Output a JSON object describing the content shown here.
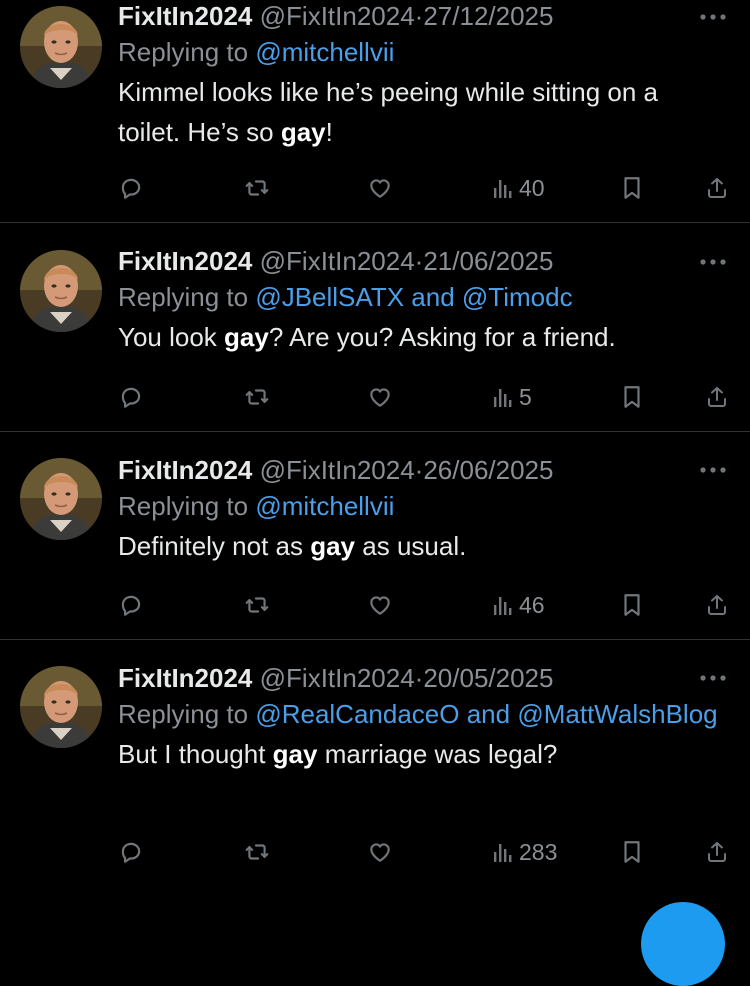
{
  "colors": {
    "background": "#000000",
    "text": "#e7e9ea",
    "muted": "#8b9096",
    "mention": "#4a9fe8",
    "divider": "#2f3336",
    "accent": "#1d9bf0"
  },
  "tweets": [
    {
      "display_name": "FixItIn2024",
      "handle": "@FixItIn2024",
      "separator": "·",
      "date": "27/12/2025",
      "reply_prefix": "Replying to",
      "reply_to": "@mitchellvii",
      "reply_joiner": "",
      "reply_to_2": "",
      "text_before": "Kimmel looks like he’s peeing while sitting on a toilet.  He’s so ",
      "text_bold": "gay",
      "text_after": "!",
      "views": "40",
      "icons": [
        "reply-icon",
        "retweet-icon",
        "like-icon",
        "views-icon",
        "bookmark-icon",
        "share-icon"
      ]
    },
    {
      "display_name": "FixItIn2024",
      "handle": "@FixItIn2024",
      "separator": "·",
      "date": "21/06/2025",
      "reply_prefix": "Replying to",
      "reply_to": "@JBellSATX",
      "reply_joiner": "and",
      "reply_to_2": "@Timodc",
      "text_before": "You look ",
      "text_bold": "gay",
      "text_after": "?  Are you?  Asking for a friend.",
      "views": "5",
      "icons": [
        "reply-icon",
        "retweet-icon",
        "like-icon",
        "views-icon",
        "bookmark-icon",
        "share-icon"
      ]
    },
    {
      "display_name": "FixItIn2024",
      "handle": "@FixItIn2024",
      "separator": "·",
      "date": "26/06/2025",
      "reply_prefix": "Replying to",
      "reply_to": "@mitchellvii",
      "reply_joiner": "",
      "reply_to_2": "",
      "text_before": "Definitely not as ",
      "text_bold": "gay",
      "text_after": " as usual.",
      "views": "46",
      "icons": [
        "reply-icon",
        "retweet-icon",
        "like-icon",
        "views-icon",
        "bookmark-icon",
        "share-icon"
      ]
    },
    {
      "display_name": "FixItIn2024",
      "handle": "@FixItIn2024",
      "separator": "·",
      "date": "20/05/2025",
      "reply_prefix": "Replying to",
      "reply_to": "@RealCandaceO",
      "reply_joiner": "and",
      "reply_to_2": "@MattWalshBlog",
      "text_before": "But I thought ",
      "text_bold": "gay",
      "text_after": " marriage was legal?",
      "views": "283",
      "icons": [
        "reply-icon",
        "retweet-icon",
        "like-icon",
        "views-icon",
        "bookmark-icon",
        "share-icon"
      ]
    }
  ]
}
